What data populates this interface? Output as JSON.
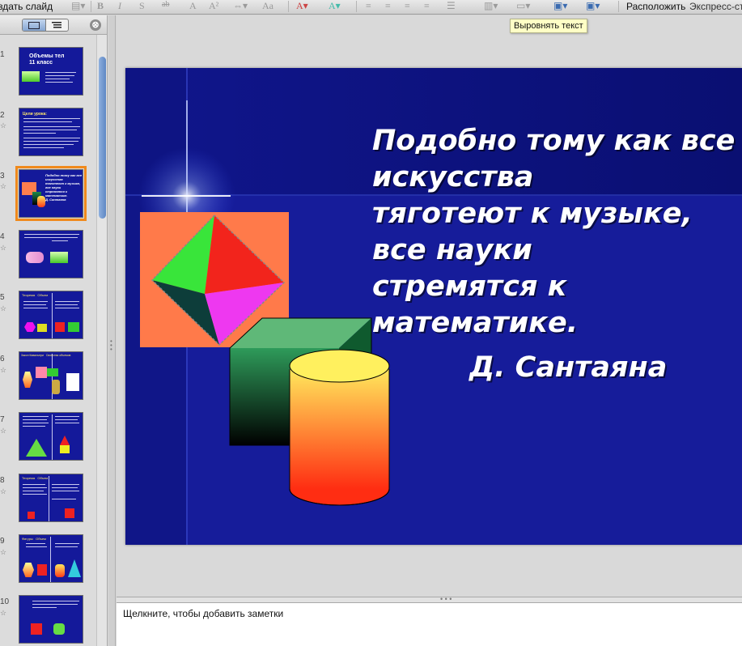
{
  "toolbar": {
    "create_slide_label": "здать слайд",
    "arrange_label": "Расположить",
    "express_styles_label": "Экспресс-сти",
    "format_buttons": [
      "I",
      "S",
      "A",
      "A²",
      "ab",
      "Aa"
    ]
  },
  "tooltip": {
    "align_text": "Выровнять текст"
  },
  "slide_panel": {
    "close_symbol": "⊗",
    "view_modes": [
      "slides",
      "outline"
    ],
    "slides": [
      {
        "num": "1",
        "title": "Объемы тел\n11 класс",
        "star": false
      },
      {
        "num": "2",
        "title": "Цели урока:",
        "star": true
      },
      {
        "num": "3",
        "title": "Подобно тому как все\nискусства\nтяготеют к музыке,\nвсе науки\nстремятся к\nматематике.\nД. Сантаяна",
        "star": true,
        "selected": true
      },
      {
        "num": "4",
        "title": "",
        "star": true
      },
      {
        "num": "5",
        "title": "Теорема   Объем",
        "star": true
      },
      {
        "num": "6",
        "title": "Закон Кавальери   Свойства объемов",
        "star": true
      },
      {
        "num": "7",
        "title": "",
        "star": true
      },
      {
        "num": "8",
        "title": "Теорема   Объем",
        "star": true
      },
      {
        "num": "9",
        "title": "Фигуры   Объем",
        "star": true
      },
      {
        "num": "10",
        "title": "",
        "star": true
      }
    ]
  },
  "main_slide": {
    "quote": "Подобно тому как все\nискусства\nтяготеют к музыке,\nвсе науки\nстремятся к\nматематике.",
    "author": "Д. Сантаяна",
    "colors": {
      "background": "#161c9a",
      "accent_band": "#0e1480",
      "text": "#ffffff"
    }
  },
  "notes": {
    "placeholder": "Щелкните, чтобы добавить заметки"
  }
}
